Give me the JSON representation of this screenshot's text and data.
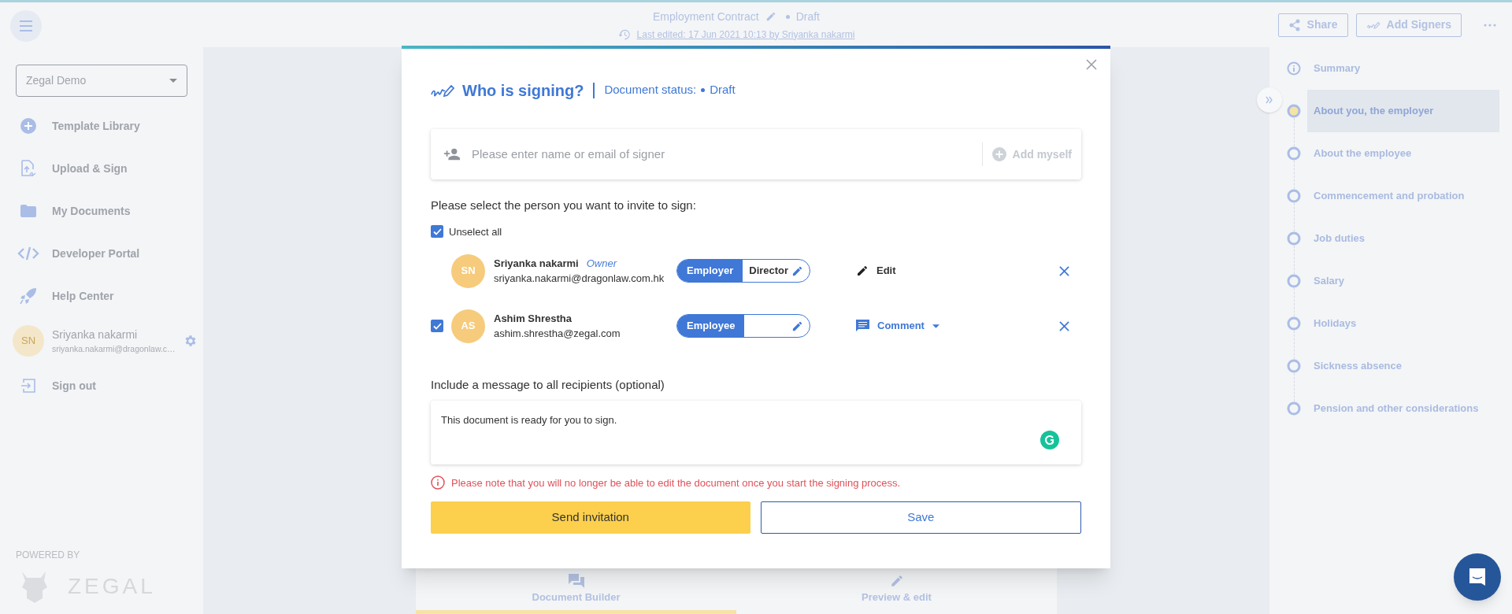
{
  "header": {
    "title": "Employment Contract",
    "status": "Draft",
    "last_edited": "Last edited: 17 Jun 2021 10:13 by Sriyanka nakarmi",
    "buttons": [
      "Share",
      "Add Signers"
    ]
  },
  "sidebar": {
    "workspace": "Zegal Demo",
    "items": [
      "Template Library",
      "Upload & Sign",
      "My Documents",
      "Developer Portal",
      "Help Center"
    ],
    "user": {
      "initials": "SN",
      "name": "Sriyanka nakarmi",
      "email": "sriyanka.nakarmi@dragonlaw.c…"
    },
    "sign_out": "Sign out",
    "powered_by": "POWERED BY",
    "brand": "ZEGAL"
  },
  "modal": {
    "title": "Who is signing?",
    "status_label": "Document status:",
    "status": "Draft",
    "signer_input": {
      "placeholder": "Please enter name or email of signer",
      "add_myself": "Add myself"
    },
    "select_prompt": "Please select the person you want to invite to sign:",
    "unselect_all": {
      "label": "Unselect all",
      "checked": true
    },
    "signers": [
      {
        "kind": "owner",
        "initials": "SN",
        "name": "Sriyanka nakarmi",
        "tag": "Owner",
        "email": "sriyanka.nakarmi@dragonlaw.com.hk",
        "role": "Employer",
        "position": "Director",
        "action": {
          "kind": "edit",
          "label": "Edit"
        }
      },
      {
        "kind": "invitee",
        "checked": true,
        "initials": "AS",
        "name": "Ashim Shrestha",
        "email": "ashim.shrestha@zegal.com",
        "role": "Employee",
        "action": {
          "kind": "comment",
          "label": "Comment"
        }
      }
    ],
    "message_label": "Include a message to all recipients (optional)",
    "message": "This document is ready for you to sign.",
    "warning": "Please note that you will no longer be able to edit the document once you start the signing process.",
    "send_button": "Send invitation",
    "save_button": "Save"
  },
  "bottom_tabs": [
    {
      "label": "Document Builder",
      "selected": true
    },
    {
      "label": "Preview & edit",
      "selected": false
    }
  ],
  "outline": [
    {
      "kind": "info",
      "label": "Summary",
      "selected": false
    },
    {
      "kind": "step",
      "label": "About you, the employer",
      "selected": true
    },
    {
      "kind": "step",
      "label": "About the employee",
      "selected": false
    },
    {
      "kind": "step",
      "label": "Commencement and probation",
      "selected": false
    },
    {
      "kind": "step",
      "label": "Job duties",
      "selected": false
    },
    {
      "kind": "step",
      "label": "Salary",
      "selected": false
    },
    {
      "kind": "step",
      "label": "Holidays",
      "selected": false
    },
    {
      "kind": "step",
      "label": "Sickness absence",
      "selected": false
    },
    {
      "kind": "step",
      "label": "Pension and other considerations",
      "selected": false
    }
  ]
}
